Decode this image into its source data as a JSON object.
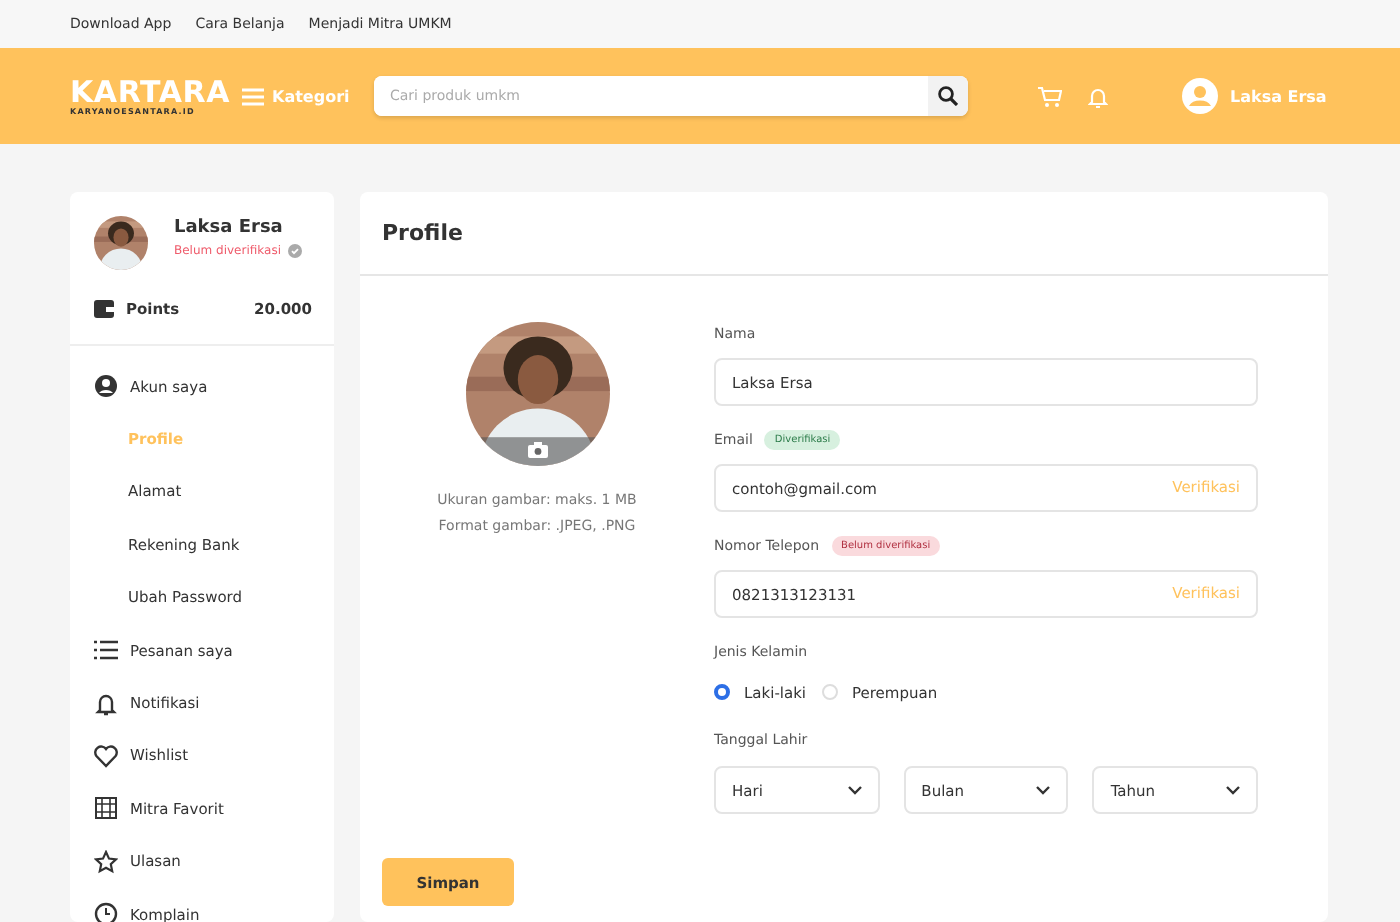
{
  "top_links": [
    "Download App",
    "Cara Belanja",
    "Menjadi Mitra UMKM"
  ],
  "header": {
    "logo": "KARTARA",
    "logo_sub": "KARYANOESANTARA.ID",
    "category": "Kategori",
    "search": {
      "placeholder": "Cari produk umkm"
    },
    "user": "Laksa Ersa"
  },
  "sidebar": {
    "user": {
      "name": "Laksa Ersa",
      "status": "Belum diverifikasi",
      "kind": "picture"
    },
    "points": {
      "label": "Points",
      "value": "20.000"
    },
    "items": [
      {
        "label": "Akun saya",
        "selected": false,
        "children": [
          {
            "label": "Profile",
            "selected": true
          },
          {
            "label": "Alamat",
            "selected": false
          },
          {
            "label": "Rekening Bank",
            "selected": false
          },
          {
            "label": "Ubah Password",
            "selected": false
          }
        ]
      },
      {
        "label": "Pesanan saya",
        "selected": false
      },
      {
        "label": "Notifikasi",
        "selected": false
      },
      {
        "label": "Wishlist",
        "selected": false
      },
      {
        "label": "Mitra Favorit",
        "selected": false
      },
      {
        "label": "Ulasan",
        "selected": false
      },
      {
        "label": "Komplain",
        "selected": false
      }
    ]
  },
  "profile": {
    "title": "Profile",
    "photo": {
      "kind": "picture",
      "notes": [
        "Ukuran gambar: maks. 1 MB",
        "Format gambar: .JPEG, .PNG"
      ]
    },
    "fields": [
      {
        "label": "Nama",
        "value": "Laksa Ersa"
      },
      {
        "label": "Email",
        "badge": "Diverifikasi",
        "kind": "verified",
        "value": "contoh@gmail.com",
        "action": "Verifikasi"
      },
      {
        "label": "Nomor Telepon",
        "badge": "Belum diverifikasi",
        "kind": "unverified",
        "value": "0821313123131",
        "action": "Verifikasi"
      }
    ],
    "gender": {
      "label": "Jenis Kelamin",
      "options": [
        {
          "label": "Laki-laki",
          "selected": true
        },
        {
          "label": "Perempuan",
          "selected": false
        }
      ]
    },
    "birthdate": {
      "label": "Tanggal Lahir",
      "selects": [
        "Hari",
        "Bulan",
        "Tahun"
      ]
    },
    "save": "Simpan"
  }
}
